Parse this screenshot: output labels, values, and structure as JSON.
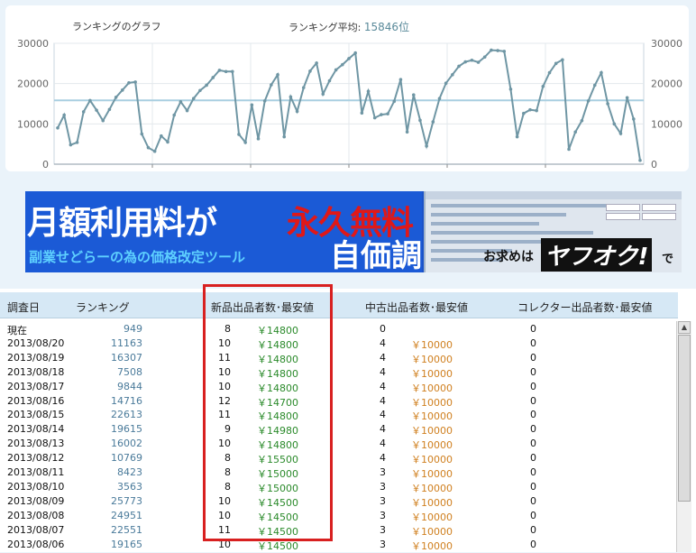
{
  "chart_header": {
    "title": "ランキングのグラフ",
    "avg_label": "ランキング平均:",
    "avg_value": "15846位"
  },
  "chart_data": {
    "type": "line",
    "title": "ランキングのグラフ",
    "ylim": [
      0,
      30000
    ],
    "yticks": [
      "0",
      "10000",
      "20000",
      "30000"
    ],
    "average": 15846,
    "grid": true,
    "values": [
      9000,
      12200,
      4800,
      5400,
      13000,
      15800,
      13400,
      10800,
      13600,
      16600,
      18400,
      20200,
      20400,
      7500,
      4100,
      3200,
      7000,
      5500,
      12200,
      15500,
      13300,
      16300,
      18300,
      19600,
      21500,
      23300,
      23000,
      23000,
      7400,
      5400,
      14700,
      6300,
      15700,
      19700,
      22200,
      6800,
      16700,
      13100,
      19000,
      23100,
      25100,
      17400,
      20700,
      23400,
      24700,
      26200,
      27600,
      12700,
      18100,
      11500,
      12300,
      12500,
      15600,
      21000,
      8000,
      17200,
      10900,
      4500,
      10500,
      16300,
      20100,
      22200,
      24300,
      25400,
      25800,
      25300,
      26600,
      28300,
      28200,
      28000,
      18600,
      6800,
      12600,
      13500,
      13300,
      19300,
      22700,
      25000,
      25900,
      3700,
      8000,
      10800,
      15700,
      19600,
      22700,
      15000,
      10000,
      7600,
      16500,
      11200,
      949
    ],
    "series_color": "#6f96a4",
    "average_color": "#a9cfe0"
  },
  "banner": {
    "title_white": "月額利用料が",
    "title_red": "永久無料",
    "subtitle": "副業せどらーの為の価格改定ツール",
    "big_text": "自価調",
    "cta": "お求めは",
    "logo": "ヤフオク!",
    "cta_tail": "で"
  },
  "table": {
    "headers": {
      "date": "調査日",
      "rank": "ランキング",
      "new": "新品出品者数･最安値",
      "used": "中古出品者数･最安値",
      "collector": "コレクター出品者数･最安値"
    },
    "rows": [
      {
        "date": "現在",
        "rank": "949",
        "new_count": "8",
        "new_price": "￥14800",
        "used_count": "0",
        "used_price": "",
        "col_count": "0"
      },
      {
        "date": "2013/08/20",
        "rank": "11163",
        "new_count": "10",
        "new_price": "￥14800",
        "used_count": "4",
        "used_price": "￥10000",
        "col_count": "0"
      },
      {
        "date": "2013/08/19",
        "rank": "16307",
        "new_count": "11",
        "new_price": "￥14800",
        "used_count": "4",
        "used_price": "￥10000",
        "col_count": "0"
      },
      {
        "date": "2013/08/18",
        "rank": "7508",
        "new_count": "10",
        "new_price": "￥14800",
        "used_count": "4",
        "used_price": "￥10000",
        "col_count": "0"
      },
      {
        "date": "2013/08/17",
        "rank": "9844",
        "new_count": "10",
        "new_price": "￥14800",
        "used_count": "4",
        "used_price": "￥10000",
        "col_count": "0"
      },
      {
        "date": "2013/08/16",
        "rank": "14716",
        "new_count": "12",
        "new_price": "￥14700",
        "used_count": "4",
        "used_price": "￥10000",
        "col_count": "0"
      },
      {
        "date": "2013/08/15",
        "rank": "22613",
        "new_count": "11",
        "new_price": "￥14800",
        "used_count": "4",
        "used_price": "￥10000",
        "col_count": "0"
      },
      {
        "date": "2013/08/14",
        "rank": "19615",
        "new_count": "9",
        "new_price": "￥14980",
        "used_count": "4",
        "used_price": "￥10000",
        "col_count": "0"
      },
      {
        "date": "2013/08/13",
        "rank": "16002",
        "new_count": "10",
        "new_price": "￥14800",
        "used_count": "4",
        "used_price": "￥10000",
        "col_count": "0"
      },
      {
        "date": "2013/08/12",
        "rank": "10769",
        "new_count": "8",
        "new_price": "￥15500",
        "used_count": "4",
        "used_price": "￥10000",
        "col_count": "0"
      },
      {
        "date": "2013/08/11",
        "rank": "8423",
        "new_count": "8",
        "new_price": "￥15000",
        "used_count": "3",
        "used_price": "￥10000",
        "col_count": "0"
      },
      {
        "date": "2013/08/10",
        "rank": "3563",
        "new_count": "8",
        "new_price": "￥15000",
        "used_count": "3",
        "used_price": "￥10000",
        "col_count": "0"
      },
      {
        "date": "2013/08/09",
        "rank": "25773",
        "new_count": "10",
        "new_price": "￥14500",
        "used_count": "3",
        "used_price": "￥10000",
        "col_count": "0"
      },
      {
        "date": "2013/08/08",
        "rank": "24951",
        "new_count": "10",
        "new_price": "￥14500",
        "used_count": "3",
        "used_price": "￥10000",
        "col_count": "0"
      },
      {
        "date": "2013/08/07",
        "rank": "22551",
        "new_count": "11",
        "new_price": "￥14500",
        "used_count": "3",
        "used_price": "￥10000",
        "col_count": "0"
      },
      {
        "date": "2013/08/06",
        "rank": "19165",
        "new_count": "10",
        "new_price": "￥14500",
        "used_count": "3",
        "used_price": "￥10000",
        "col_count": "0"
      }
    ]
  },
  "scrollbar": {
    "up_icon": "▲",
    "down_icon": "▼"
  }
}
